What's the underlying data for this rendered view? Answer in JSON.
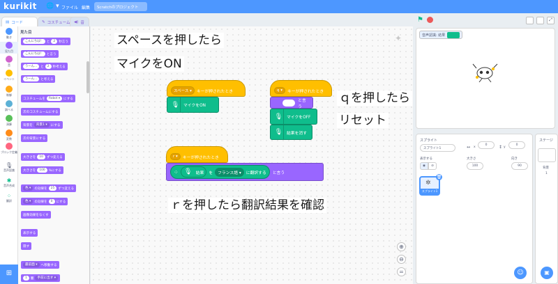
{
  "menu": {
    "logo": "kurikit",
    "globe": "🌐 ▾",
    "file": "ファイル",
    "edit": "編集",
    "project_title": "Scratchのプロジェクト"
  },
  "tabs": {
    "code": "コード",
    "costume": "コスチューム",
    "sound": "音"
  },
  "categories": [
    {
      "label": "動き",
      "color": "#4c97ff"
    },
    {
      "label": "見た目",
      "color": "#9966ff"
    },
    {
      "label": "音",
      "color": "#cf63cf"
    },
    {
      "label": "イベント",
      "color": "#ffbf00"
    },
    {
      "label": "制御",
      "color": "#ffab19"
    },
    {
      "label": "調べる",
      "color": "#5cb1d6"
    },
    {
      "label": "演算",
      "color": "#59c059"
    },
    {
      "label": "変数",
      "color": "#ff8c1a"
    },
    {
      "label": "ブロック定義",
      "color": "#ff6680"
    },
    {
      "label": "音声認識",
      "color": "#0fbd8c"
    },
    {
      "label": "音声合成",
      "color": "#0fbd8c"
    },
    {
      "label": "翻訳",
      "color": "#0fbd8c"
    }
  ],
  "palette": {
    "heading": "見た目",
    "b1": {
      "a": "こんにちは！",
      "b": "と",
      "c": "2",
      "d": "秒言う"
    },
    "b2": {
      "a": "こんにちは！",
      "b": "と言う"
    },
    "b3": {
      "a": "うーん…",
      "b": "と",
      "c": "2",
      "d": "秒考える"
    },
    "b4": {
      "a": "うーん…",
      "b": "と考える"
    },
    "b5": {
      "a": "コスチュームを",
      "b": "Robot ▾",
      "c": "にする"
    },
    "b6": "次のコスチュームにする",
    "b7": {
      "a": "背景を",
      "b": "背景1 ▾",
      "c": "にする"
    },
    "b8": "次の背景にする",
    "b9": {
      "a": "大きさを",
      "b": "10",
      "c": "ずつ変える"
    },
    "b10": {
      "a": "大きさを",
      "b": "100",
      "c": "%にする"
    },
    "b11": {
      "a": "色 ▾",
      "b": "の効果を",
      "c": "25",
      "d": "ずつ変える"
    },
    "b12": {
      "a": "色 ▾",
      "b": "の効果を",
      "c": "0",
      "d": "にする"
    },
    "b13": "画像効果をなくす",
    "b14": "表示する",
    "b15": "隠す",
    "b16": {
      "a": "最前面 ▾",
      "b": "へ移動する"
    },
    "b17": {
      "a": "1",
      "b": "層",
      "c": "手前に出す ▾"
    }
  },
  "notes": {
    "n1": "スペースを押したら",
    "n2": "マイクをON",
    "n3": "ｑを押したら",
    "n4": "リセット",
    "n5": "ｒを押したら翻訳結果を確認"
  },
  "scripts": {
    "s1": {
      "key": "スペース ▾",
      "hat": "キーが押されたとき",
      "cmd": "マイクをON"
    },
    "s2": {
      "key": "q ▾",
      "hat": "キーが押されたとき",
      "say": "と言う",
      "cmd1": "マイクをOFF",
      "cmd2": "結果を消す"
    },
    "s3": {
      "key": "r ▾",
      "hat": "キーが押されたとき",
      "result": "結果",
      "wo": "を",
      "lang": "フランス語 ▾",
      "to": "に翻訳する",
      "say": "と言う"
    }
  },
  "stage": {
    "monitor_label": "音声認識: 結果",
    "monitor_color": "#0fbd8c"
  },
  "sprite_panel": {
    "title": "スプライト",
    "name": "スプライト1",
    "x_label": "x",
    "x": "0",
    "y_label": "y",
    "y": "0",
    "show_label": "表示する",
    "size_label": "大きさ",
    "size": "100",
    "dir_label": "向き",
    "dir": "90",
    "thumb_label": "スプライト1"
  },
  "stage_panel": {
    "title": "ステージ",
    "backdrop_label": "背景",
    "backdrop_count": "1"
  }
}
